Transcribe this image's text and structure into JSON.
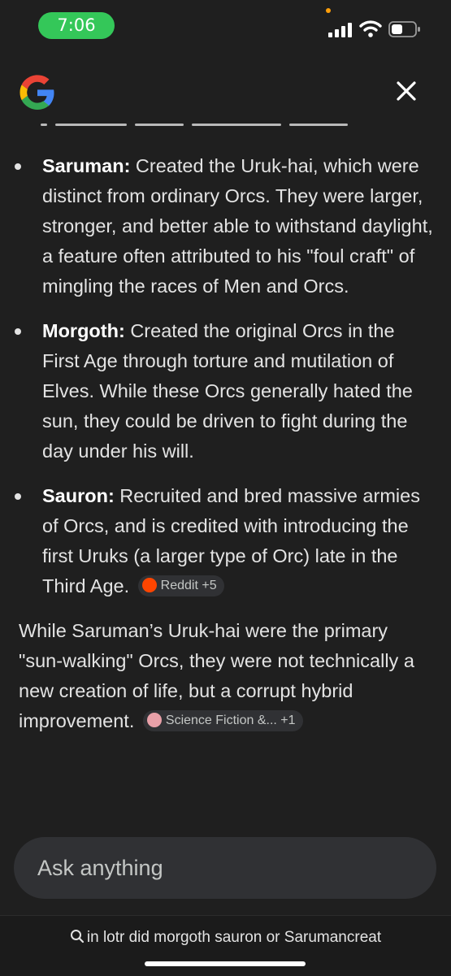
{
  "status_bar": {
    "time": "7:06"
  },
  "colors": {
    "background": "#1f1f1f",
    "time_pill": "#34c759",
    "chip_background": "#303134",
    "reddit": "#ff4500"
  },
  "header": {
    "logo_icon": "google-g-icon",
    "close_icon": "close-icon"
  },
  "bullets": [
    {
      "term": "Saruman:",
      "text": " Created the Uruk-hai, which were distinct from ordinary Orcs. They were larger, stronger, and better able to withstand daylight, a feature often attributed to his \"foul craft\" of mingling the races of Men and Orcs."
    },
    {
      "term": "Morgoth:",
      "text": " Created the original Orcs in the First Age through torture and mutilation of Elves. While these Orcs generally hated the sun, they could be driven to fight during the day under his will."
    },
    {
      "term": "Sauron:",
      "text": " Recruited and bred massive armies of Orcs, and is credited with introducing the first Uruks (a larger type of Orc) late in the Third Age.",
      "chip": "Reddit +5"
    }
  ],
  "paragraph": {
    "text": "While Saruman’s Uruk-hai were the primary \"sun-walking\" Orcs, they were not technically a new creation of life, but a corrupt hybrid improvement.",
    "chip": "Science Fiction &... +1"
  },
  "ask": {
    "placeholder": "Ask anything"
  },
  "bottom": {
    "query": "in lotr did morgoth sauron or Sarumancreat"
  }
}
